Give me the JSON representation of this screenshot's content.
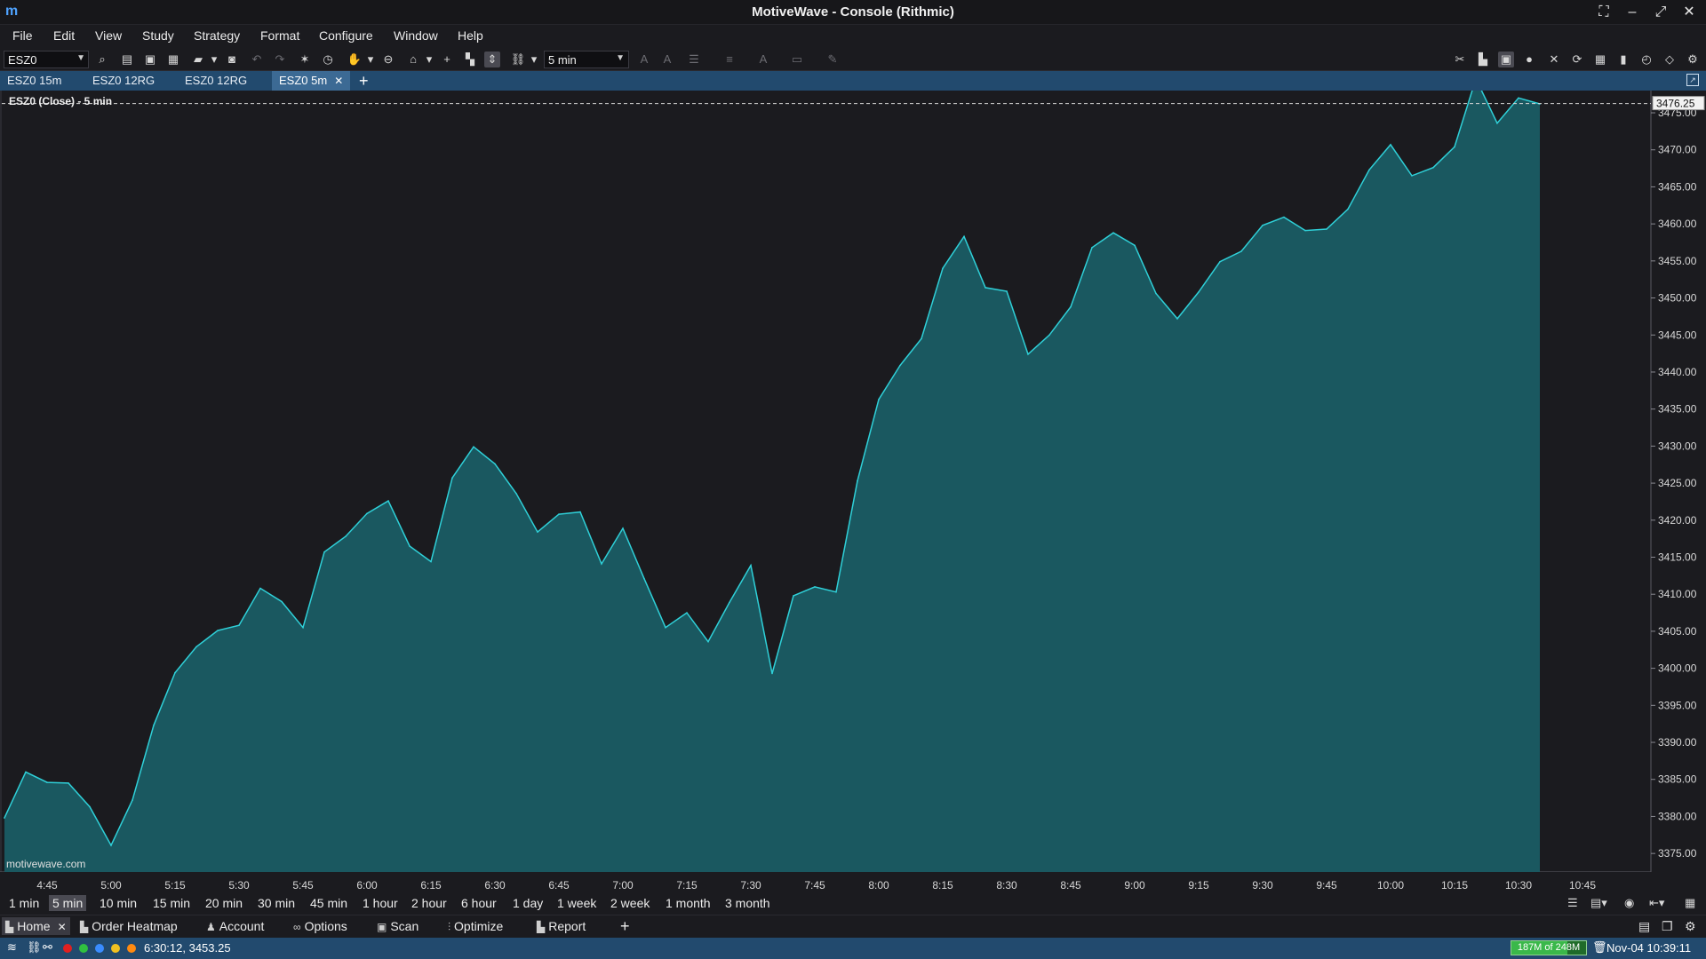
{
  "app": {
    "title": "MotiveWave - Console (Rithmic)",
    "logo": "m"
  },
  "window_controls": [
    {
      "name": "fullscreen-icon",
      "glyph": "⛶"
    },
    {
      "name": "minimize-icon",
      "glyph": "–"
    },
    {
      "name": "maximize-icon",
      "glyph": "⤢"
    },
    {
      "name": "close-icon",
      "glyph": "✕"
    }
  ],
  "menu": [
    "File",
    "Edit",
    "View",
    "Study",
    "Strategy",
    "Format",
    "Configure",
    "Window",
    "Help"
  ],
  "toolbar": {
    "symbol": "ESZ0",
    "bar_size": "5 min"
  },
  "chart_tabs": [
    {
      "label": "ESZ0 15m",
      "active": false
    },
    {
      "label": "ESZ0 12RG",
      "active": false
    },
    {
      "label": "ESZ0 12RG",
      "active": false
    },
    {
      "label": "ESZ0 5m",
      "active": true
    }
  ],
  "tab_close": "✕",
  "tab_add": "+",
  "chart_data": {
    "type": "area",
    "title": "ESZ0 (Close) - 5 min",
    "watermark": "motivewave.com",
    "last_price_label": "3476.25",
    "last_price": 3476.25,
    "ylim": [
      3372.5,
      3478
    ],
    "y_ticks": [
      3375,
      3380,
      3385,
      3390,
      3395,
      3400,
      3405,
      3410,
      3415,
      3420,
      3425,
      3430,
      3435,
      3440,
      3445,
      3450,
      3455,
      3460,
      3465,
      3470,
      3475
    ],
    "x_ticks": [
      "4:45",
      "5:00",
      "5:15",
      "5:30",
      "5:45",
      "6:00",
      "6:15",
      "6:30",
      "6:45",
      "7:00",
      "7:15",
      "7:30",
      "7:45",
      "8:00",
      "8:15",
      "8:30",
      "8:45",
      "9:00",
      "9:15",
      "9:30",
      "9:45",
      "10:00",
      "10:15",
      "10:30",
      "10:45"
    ],
    "x": [
      "4:35",
      "4:40",
      "4:45",
      "4:50",
      "4:55",
      "5:00",
      "5:05",
      "5:10",
      "5:15",
      "5:20",
      "5:25",
      "5:30",
      "5:35",
      "5:40",
      "5:45",
      "5:50",
      "5:55",
      "6:00",
      "6:05",
      "6:10",
      "6:15",
      "6:20",
      "6:25",
      "6:30",
      "6:35",
      "6:40",
      "6:45",
      "6:50",
      "6:55",
      "7:00",
      "7:05",
      "7:10",
      "7:15",
      "7:20",
      "7:25",
      "7:30",
      "7:35",
      "7:40",
      "7:45",
      "7:50",
      "7:55",
      "8:00",
      "8:05",
      "8:10",
      "8:15",
      "8:20",
      "8:25",
      "8:30",
      "8:35",
      "8:40",
      "8:45",
      "8:50",
      "8:55",
      "9:00",
      "9:05",
      "9:10",
      "9:15",
      "9:20",
      "9:25",
      "9:30",
      "9:35",
      "9:40",
      "9:45",
      "9:50",
      "9:55",
      "10:00",
      "10:05",
      "10:10",
      "10:15",
      "10:20",
      "10:25",
      "10:30",
      "10:35"
    ],
    "series": [
      {
        "color": "#2fd0d8",
        "fill": "#1a5860",
        "values": [
          3379.8,
          3386.0,
          3384.6,
          3384.5,
          3381.3,
          3376.1,
          3382.2,
          3392.3,
          3399.4,
          3402.9,
          3405.1,
          3405.8,
          3410.8,
          3409.0,
          3405.5,
          3415.7,
          3417.8,
          3420.9,
          3422.6,
          3416.5,
          3414.4,
          3425.7,
          3429.9,
          3427.6,
          3423.6,
          3418.4,
          3420.8,
          3421.1,
          3414.1,
          3418.9,
          3412.1,
          3405.5,
          3407.5,
          3403.6,
          3408.9,
          3413.9,
          3399.3,
          3409.8,
          3411.0,
          3410.3,
          3425.3,
          3436.3,
          3440.9,
          3444.5,
          3454.0,
          3458.3,
          3451.4,
          3450.9,
          3442.4,
          3445.0,
          3448.8,
          3456.8,
          3458.8,
          3457.1,
          3450.6,
          3447.2,
          3450.8,
          3454.9,
          3456.3,
          3459.8,
          3460.9,
          3459.1,
          3459.3,
          3462.0,
          3467.3,
          3470.7,
          3466.5,
          3467.6,
          3470.4,
          3479.6,
          3473.6,
          3477.0,
          3476.2
        ]
      }
    ]
  },
  "periods": [
    {
      "label": "1 min",
      "active": false
    },
    {
      "label": "5 min",
      "active": true
    },
    {
      "label": "10 min",
      "active": false
    },
    {
      "label": "15 min",
      "active": false
    },
    {
      "label": "20 min",
      "active": false
    },
    {
      "label": "30 min",
      "active": false
    },
    {
      "label": "45 min",
      "active": false
    },
    {
      "label": "1 hour",
      "active": false
    },
    {
      "label": "2 hour",
      "active": false
    },
    {
      "label": "6 hour",
      "active": false
    },
    {
      "label": "1 day",
      "active": false
    },
    {
      "label": "1 week",
      "active": false
    },
    {
      "label": "2 week",
      "active": false
    },
    {
      "label": "1 month",
      "active": false
    },
    {
      "label": "3 month",
      "active": false
    }
  ],
  "bottom_tabs": [
    {
      "label": "Home",
      "icon": "chart-icon",
      "active": true,
      "closable": true
    },
    {
      "label": "Order Heatmap",
      "icon": "heatmap-icon",
      "active": false
    },
    {
      "label": "Account",
      "icon": "account-icon",
      "active": false
    },
    {
      "label": "Options",
      "icon": "options-icon",
      "active": false
    },
    {
      "label": "Scan",
      "icon": "scan-icon",
      "active": false
    },
    {
      "label": "Optimize",
      "icon": "optimize-icon",
      "active": false
    },
    {
      "label": "Report",
      "icon": "report-icon",
      "active": false
    }
  ],
  "bottom_add": "+",
  "status": {
    "coords": "6:30:12, 3453.25",
    "memory": "187M of 248M",
    "memory_fraction": 0.754,
    "clock": "Nov-04 10:39:11",
    "dot_colors": [
      "#e02020",
      "#30c040",
      "#3a8cff",
      "#f0c020",
      "#ff8a10"
    ]
  }
}
